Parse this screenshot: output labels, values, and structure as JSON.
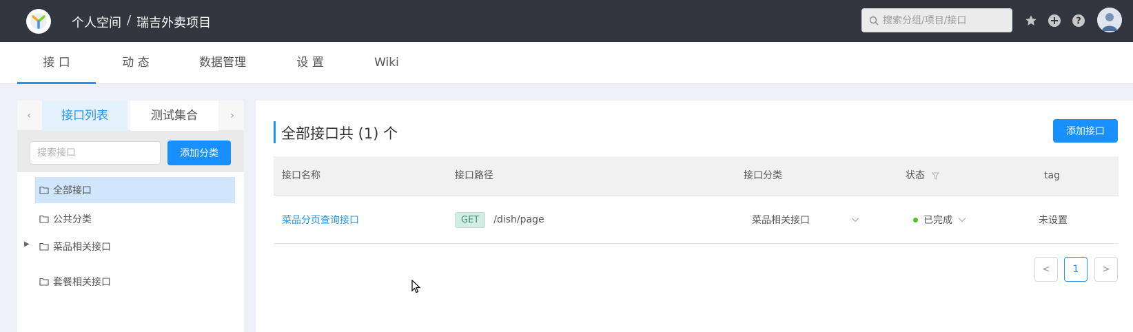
{
  "header": {
    "breadcrumb": [
      "个人空间",
      "瑞吉外卖项目"
    ],
    "breadcrumb_sep": "/",
    "search_placeholder": "搜索分组/项目/接口",
    "icons": [
      "star-icon",
      "plus-circle-icon",
      "help-icon",
      "avatar"
    ]
  },
  "subnav": {
    "tabs": [
      "接 口",
      "动 态",
      "数据管理",
      "设 置",
      "Wiki"
    ],
    "active": 0
  },
  "left": {
    "tabs": [
      "接口列表",
      "测试集合"
    ],
    "search_placeholder": "搜索接口",
    "add_category": "添加分类",
    "categories": [
      "全部接口",
      "公共分类",
      "菜品相关接口",
      "套餐相关接口"
    ]
  },
  "main": {
    "title": "全部接口共 (1) 个",
    "add_button": "添加接口",
    "columns": [
      "接口名称",
      "接口路径",
      "接口分类",
      "状态",
      "tag"
    ],
    "rows": [
      {
        "name": "菜品分页查询接口",
        "method": "GET",
        "path": "/dish/page",
        "category": "菜品相关接口",
        "status": "已完成",
        "tag": "未设置"
      }
    ],
    "pagination": {
      "prev": "<",
      "current": "1",
      "next": ">"
    }
  },
  "colors": {
    "accent": "#2395f1",
    "header_bg": "#32363f",
    "status_done": "#52c41a"
  }
}
